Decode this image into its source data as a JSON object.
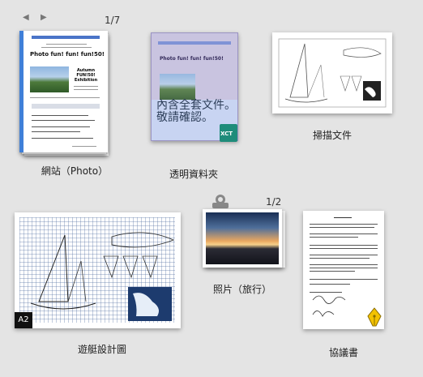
{
  "items": [
    {
      "label": "網站（Photo）",
      "counter": "1/7"
    },
    {
      "label": "透明資料夾",
      "overlay_text": "內含全套文件。\n敬請確認。",
      "badge": "XCT"
    },
    {
      "label": "掃描文件"
    },
    {
      "label": "遊艇設計圖",
      "badge": "A2"
    },
    {
      "label": "照片（旅行）",
      "counter": "1/2"
    },
    {
      "label": "協議書"
    }
  ],
  "web_mock": {
    "title": "Photo fun! fun! fun!50!",
    "side_title": "Autumn\nFUN!50!\nExhibition"
  },
  "icons": [
    "prev-arrow-icon",
    "next-arrow-icon",
    "clip-icon",
    "pen-nib-icon"
  ]
}
